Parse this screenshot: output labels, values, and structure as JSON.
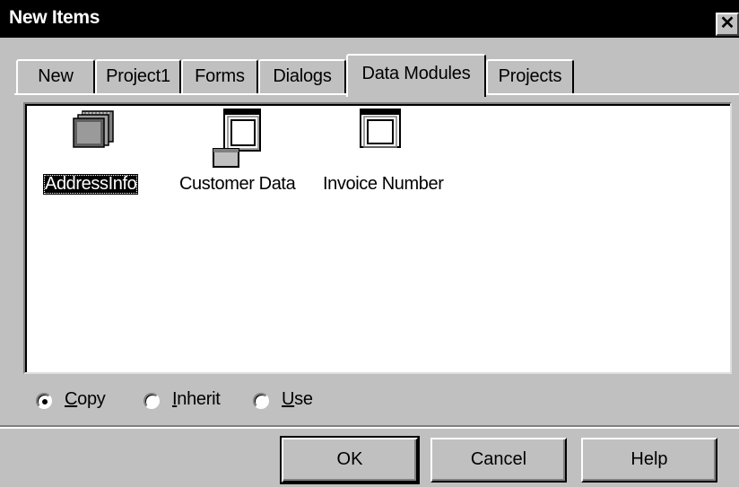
{
  "window": {
    "title": "New Items",
    "close_glyph": "✕"
  },
  "tabs": [
    {
      "label": "New",
      "selected": false
    },
    {
      "label": "Project1",
      "selected": false
    },
    {
      "label": "Forms",
      "selected": false
    },
    {
      "label": "Dialogs",
      "selected": false
    },
    {
      "label": "Data Modules",
      "selected": true
    },
    {
      "label": "Projects",
      "selected": false
    }
  ],
  "items": [
    {
      "label": "AddressInfo",
      "icon": "datamodule-stack-icon",
      "selected": true
    },
    {
      "label": "Customer Data",
      "icon": "datamodule-window-icon",
      "selected": false
    },
    {
      "label": "Invoice Number",
      "icon": "datamodule-window-icon",
      "selected": false
    }
  ],
  "options": [
    {
      "prefix": "",
      "accel": "C",
      "rest": "opy",
      "checked": true
    },
    {
      "prefix": "",
      "accel": "I",
      "rest": "nherit",
      "checked": false
    },
    {
      "prefix": "",
      "accel": "U",
      "rest": "se",
      "checked": false
    }
  ],
  "buttons": {
    "ok": "OK",
    "cancel": "Cancel",
    "help": "Help"
  }
}
